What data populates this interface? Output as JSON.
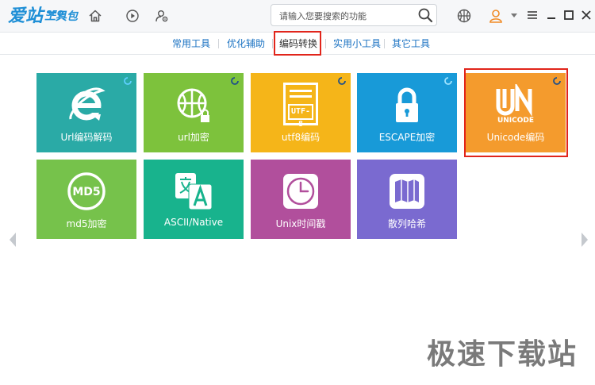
{
  "app": {
    "logo_main": "爱站",
    "logo_sub": "工具包",
    "logo_seo": "SEO"
  },
  "search": {
    "placeholder": "请输入您要搜索的功能"
  },
  "tabs": [
    {
      "label": "常用工具"
    },
    {
      "label": "优化辅助"
    },
    {
      "label": "编码转换",
      "active": true
    },
    {
      "label": "实用小工具"
    },
    {
      "label": "其它工具"
    }
  ],
  "tiles": [
    {
      "label": "Url编码解码",
      "color": "#2aaaa6",
      "icon": "internet-explorer-icon"
    },
    {
      "label": "url加密",
      "color": "#7dc23c",
      "icon": "globe-lock-icon"
    },
    {
      "label": "utf8编码",
      "color": "#f5b519",
      "icon": "utf8-document-icon",
      "icon_text": "UTF-8"
    },
    {
      "label": "ESCAPE加密",
      "color": "#189ad8",
      "icon": "padlock-icon"
    },
    {
      "label": "Unicode编码",
      "color": "#f49b2d",
      "icon": "unicode-logo-icon",
      "icon_text": "UNICODE",
      "highlighted": true
    },
    {
      "label": "md5加密",
      "color": "#76c24b",
      "icon": "md5-badge-icon",
      "icon_text": "MD5"
    },
    {
      "label": "ASCII/Native",
      "color": "#18b38d",
      "icon": "translate-icon"
    },
    {
      "label": "Unix时间戳",
      "color": "#b14f9c",
      "icon": "clock-icon"
    },
    {
      "label": "散列哈希",
      "color": "#7a6ad0",
      "icon": "map-icon"
    }
  ],
  "watermark": "极速下载站",
  "colors": {
    "accent": "#1f8fd6",
    "highlight": "#e1251b",
    "tab_link": "#1a72c2"
  }
}
